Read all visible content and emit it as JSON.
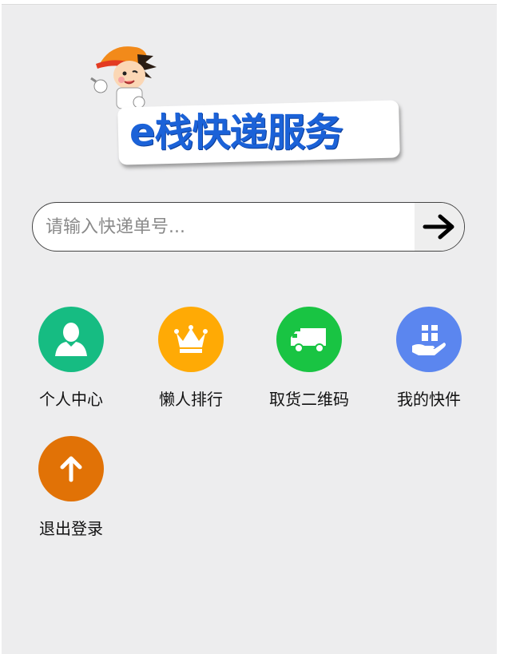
{
  "logo": {
    "text": "e栈快递服务"
  },
  "search": {
    "placeholder": "请输入快递单号..."
  },
  "menu": [
    {
      "label": "个人中心",
      "icon": "user-icon",
      "color": "#16bc82"
    },
    {
      "label": "懒人排行",
      "icon": "crown-icon",
      "color": "#ffaa05"
    },
    {
      "label": "取货二维码",
      "icon": "truck-icon",
      "color": "#19c443"
    },
    {
      "label": "我的快件",
      "icon": "package-hand-icon",
      "color": "#5b86ef"
    },
    {
      "label": "退出登录",
      "icon": "arrow-up-icon",
      "color": "#e17206"
    }
  ]
}
